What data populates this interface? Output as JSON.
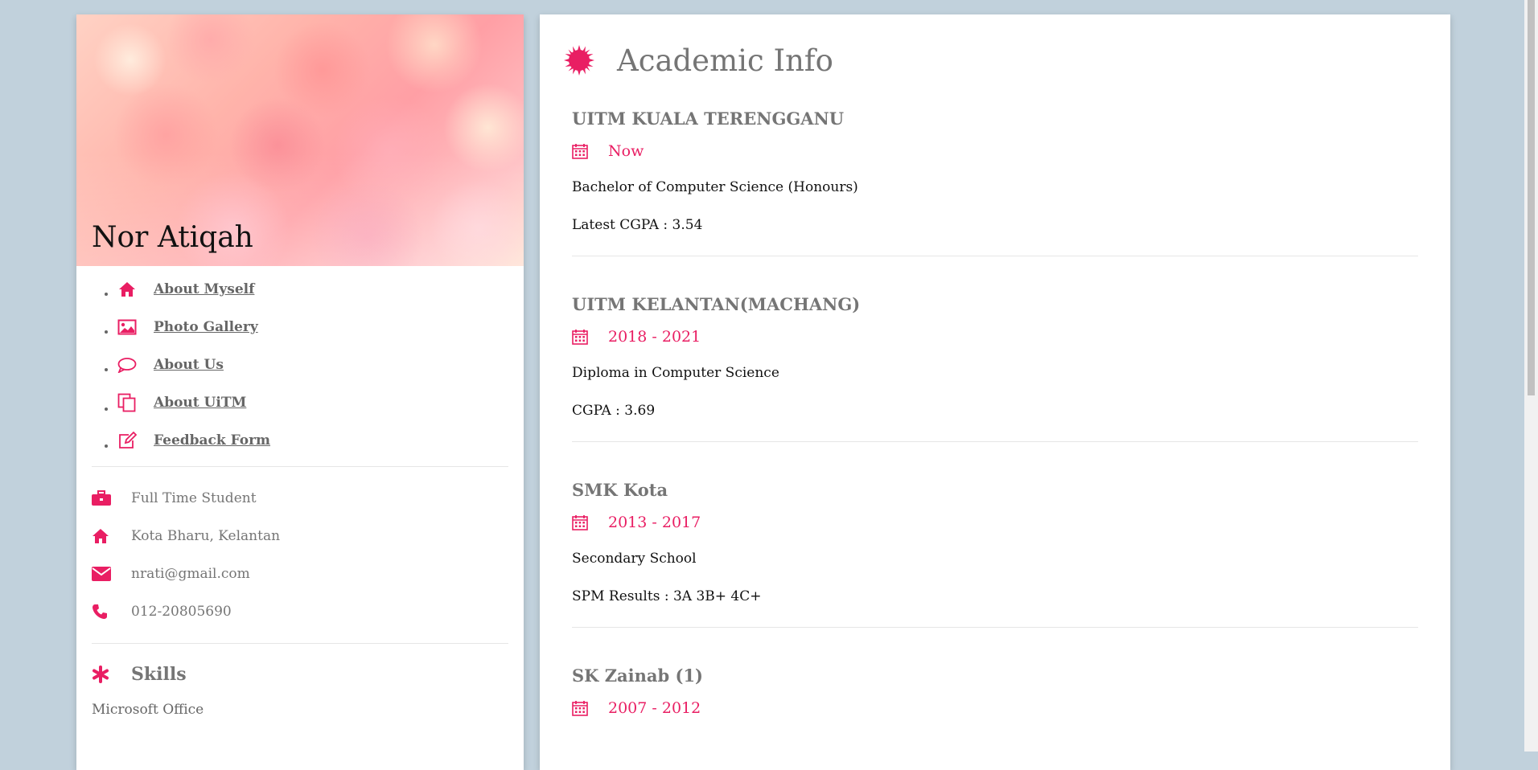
{
  "profile": {
    "name": "Nor Atiqah"
  },
  "nav": [
    {
      "label": "About Myself",
      "icon": "home-icon"
    },
    {
      "label": "Photo Gallery",
      "icon": "image-icon"
    },
    {
      "label": "About Us",
      "icon": "comment-icon"
    },
    {
      "label": "About UiTM",
      "icon": "copy-icon"
    },
    {
      "label": "Feedback Form",
      "icon": "edit-icon"
    }
  ],
  "info": {
    "status": "Full Time Student",
    "location": "Kota Bharu, Kelantan",
    "email": "nrati@gmail.com",
    "phone": "012-20805690"
  },
  "skills": {
    "title": "Skills",
    "items": [
      "Microsoft Office"
    ]
  },
  "academic": {
    "title": "Academic Info",
    "entries": [
      {
        "school": "UITM KUALA TERENGGANU",
        "date": "Now",
        "line1": "Bachelor of Computer Science (Honours)",
        "line2": "Latest CGPA : 3.54"
      },
      {
        "school": "UITM KELANTAN(MACHANG)",
        "date": "2018 - 2021",
        "line1": "Diploma in Computer Science",
        "line2": "CGPA : 3.69"
      },
      {
        "school": "SMK Kota",
        "date": "2013 - 2017",
        "line1": "Secondary School",
        "line2": "SPM Results : 3A 3B+ 4C+"
      },
      {
        "school": "SK Zainab (1)",
        "date": "2007 - 2012",
        "line1": "",
        "line2": ""
      }
    ]
  },
  "colors": {
    "accent": "#e91e63",
    "background": "#c1d1dc",
    "muted_text": "#757575"
  }
}
